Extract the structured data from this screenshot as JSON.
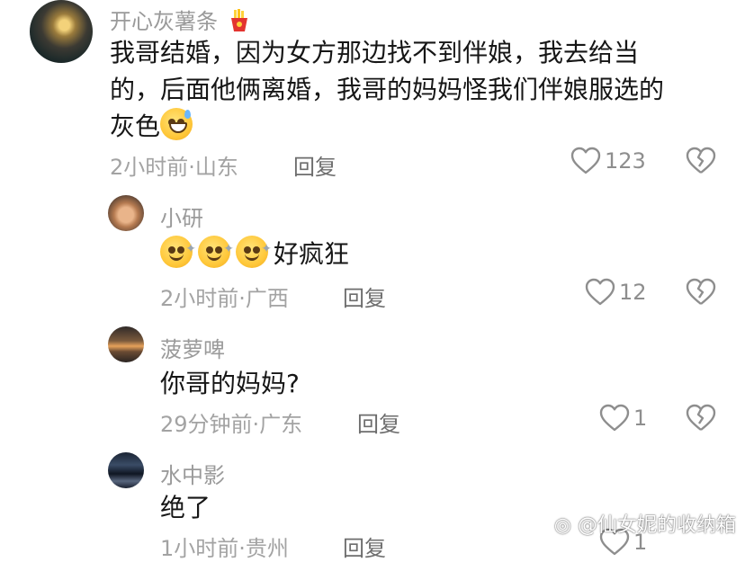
{
  "main_comment": {
    "username": "开心灰薯条",
    "username_badge_icon": "fries-emoji",
    "text_line1": "我哥结婚，因为女方那边找不到伴娘，我去给当",
    "text_line2": "的，后面他俩离婚，我哥的妈妈怪我们伴娘服选的",
    "text_line3": "灰色",
    "trailing_emoji": "grin-sweat-emoji",
    "time": "2小时前",
    "location": "山东",
    "reply_label": "回复",
    "likes": "123"
  },
  "replies": [
    {
      "username": "小研",
      "text": "好疯狂",
      "leading_emojis": [
        "dizzy-smile-emoji",
        "dizzy-smile-emoji",
        "dizzy-smile-emoji"
      ],
      "time": "2小时前",
      "location": "广西",
      "reply_label": "回复",
      "likes": "12"
    },
    {
      "username": "菠萝啤",
      "text": "你哥的妈妈?",
      "time": "29分钟前",
      "location": "广东",
      "reply_label": "回复",
      "likes": "1"
    },
    {
      "username": "水中影",
      "text": "绝了",
      "time": "1小时前",
      "location": "贵州",
      "reply_label": "回复",
      "likes": "1"
    }
  ],
  "separator": "·",
  "watermark": "@仙女妮的收纳箱",
  "colors": {
    "username": "#9a9a9a",
    "body_text": "#161616",
    "meta": "#a3a3a3",
    "reply": "#6d6d6d",
    "icon": "#8e8e8e"
  }
}
